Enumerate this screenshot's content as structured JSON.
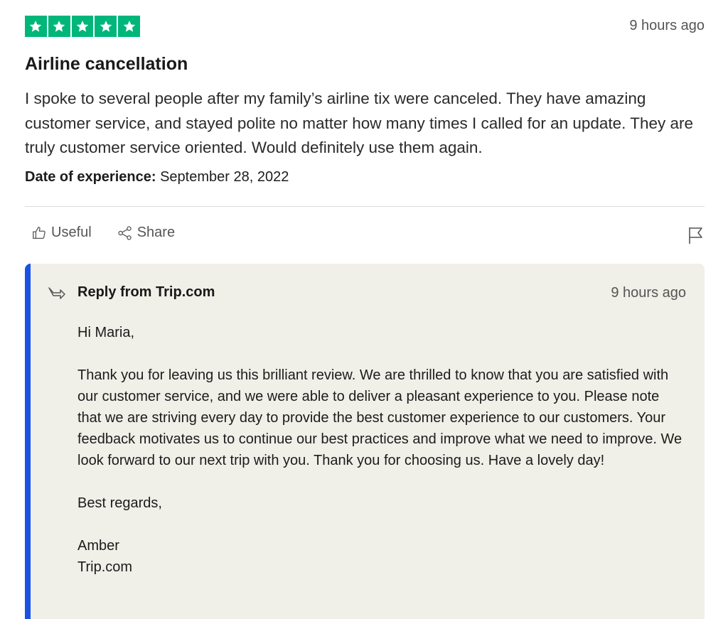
{
  "review": {
    "rating": 5,
    "rating_color": "#00b67a",
    "date": "9 hours ago",
    "title": "Airline cancellation",
    "body": "I spoke to several people after my family’s airline tix were canceled. They have amazing customer service, and stayed polite no matter how many times I called for an update. They are truly customer service oriented. Would definitely use them again.",
    "experience_label": "Date of experience:",
    "experience_date": "September 28, 2022"
  },
  "actions": {
    "useful_label": "Useful",
    "useful_icon": "thumbs-up-icon",
    "share_label": "Share",
    "share_icon": "share-icon",
    "flag_icon": "flag-icon"
  },
  "reply": {
    "accent_color": "#1c52e4",
    "background_color": "#f0efe8",
    "icon": "reply-arrow-icon",
    "title": "Reply from Trip.com",
    "date": "9 hours ago",
    "greeting": "Hi Maria,",
    "message": "Thank you for leaving us this brilliant review. We are thrilled to know that you are satisfied with our customer service, and we were able to deliver a pleasant experience to you. Please note that we are striving every day to provide the best customer experience to our customers. Your feedback motivates us to continue our best practices and improve what we need to improve. We look forward to our next trip with you. Thank you for choosing us. Have a lovely day!",
    "closing": "Best regards,",
    "signature_name": "Amber",
    "signature_company": "Trip.com"
  }
}
